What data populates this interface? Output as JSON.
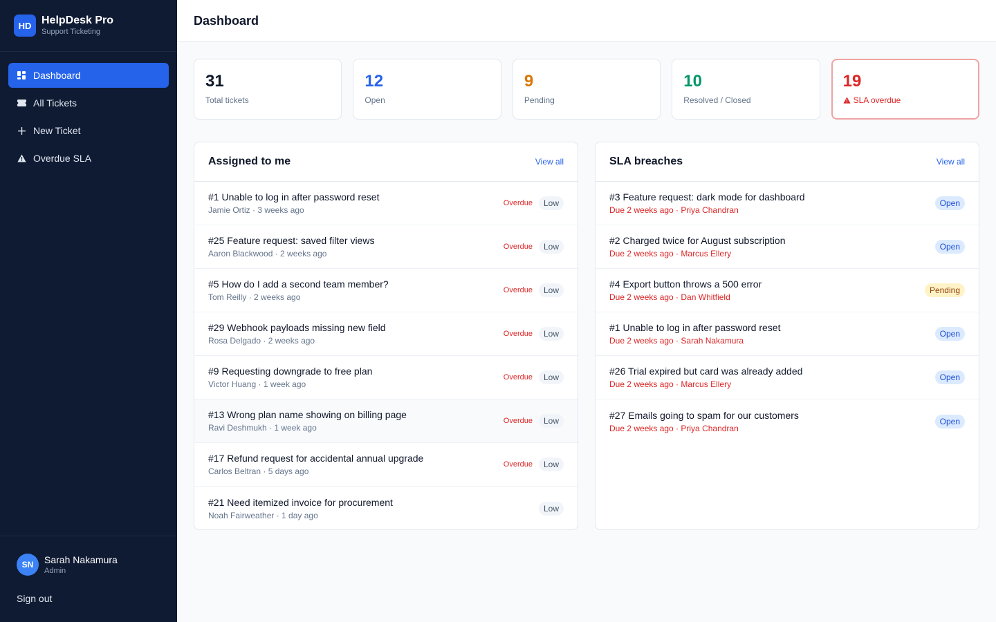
{
  "brand": {
    "logo": "HD",
    "name": "HelpDesk Pro",
    "subtitle": "Support Ticketing"
  },
  "nav": [
    {
      "label": "Dashboard",
      "icon": "dashboard-icon",
      "active": true
    },
    {
      "label": "All Tickets",
      "icon": "ticket-icon",
      "active": false
    },
    {
      "label": "New Ticket",
      "icon": "plus-icon",
      "active": false
    },
    {
      "label": "Overdue SLA",
      "icon": "warning-icon",
      "active": false
    }
  ],
  "user": {
    "initials": "SN",
    "name": "Sarah Nakamura",
    "role": "Admin",
    "signout": "Sign out"
  },
  "page": {
    "title": "Dashboard"
  },
  "stats": [
    {
      "value": "31",
      "label": "Total tickets",
      "color": "#0f172a"
    },
    {
      "value": "12",
      "label": "Open",
      "color": "#2563eb"
    },
    {
      "value": "9",
      "label": "Pending",
      "color": "#d97706"
    },
    {
      "value": "10",
      "label": "Resolved / Closed",
      "color": "#059669"
    },
    {
      "value": "19",
      "label": "SLA overdue",
      "color": "#dc2626"
    }
  ],
  "assigned": {
    "title": "Assigned to me",
    "view_all": "View all",
    "rows": [
      {
        "title": "#1 Unable to log in after password reset",
        "sub": "Jamie Ortiz · 3 weeks ago",
        "overdue": "Overdue",
        "priority": "Low"
      },
      {
        "title": "#25 Feature request: saved filter views",
        "sub": "Aaron Blackwood · 2 weeks ago",
        "overdue": "Overdue",
        "priority": "Low"
      },
      {
        "title": "#5 How do I add a second team member?",
        "sub": "Tom Reilly · 2 weeks ago",
        "overdue": "Overdue",
        "priority": "Low"
      },
      {
        "title": "#29 Webhook payloads missing new field",
        "sub": "Rosa Delgado · 2 weeks ago",
        "overdue": "Overdue",
        "priority": "Low"
      },
      {
        "title": "#9 Requesting downgrade to free plan",
        "sub": "Victor Huang · 1 week ago",
        "overdue": "Overdue",
        "priority": "Low"
      },
      {
        "title": "#13 Wrong plan name showing on billing page",
        "sub": "Ravi Deshmukh · 1 week ago",
        "overdue": "Overdue",
        "priority": "Low"
      },
      {
        "title": "#17 Refund request for accidental annual upgrade",
        "sub": "Carlos Beltran · 5 days ago",
        "overdue": "Overdue",
        "priority": "Low"
      },
      {
        "title": "#21 Need itemized invoice for procurement",
        "sub": "Noah Fairweather · 1 day ago",
        "overdue": "",
        "priority": "Low"
      }
    ]
  },
  "breaches": {
    "title": "SLA breaches",
    "view_all": "View all",
    "rows": [
      {
        "title": "#3 Feature request: dark mode for dashboard",
        "sub": "Due 2 weeks ago · Priya Chandran",
        "status": "Open"
      },
      {
        "title": "#2 Charged twice for August subscription",
        "sub": "Due 2 weeks ago · Marcus Ellery",
        "status": "Open"
      },
      {
        "title": "#4 Export button throws a 500 error",
        "sub": "Due 2 weeks ago · Dan Whitfield",
        "status": "Pending"
      },
      {
        "title": "#1 Unable to log in after password reset",
        "sub": "Due 2 weeks ago · Sarah Nakamura",
        "status": "Open"
      },
      {
        "title": "#26 Trial expired but card was already added",
        "sub": "Due 2 weeks ago · Marcus Ellery",
        "status": "Open"
      },
      {
        "title": "#27 Emails going to spam for our customers",
        "sub": "Due 2 weeks ago · Priya Chandran",
        "status": "Open"
      }
    ]
  }
}
